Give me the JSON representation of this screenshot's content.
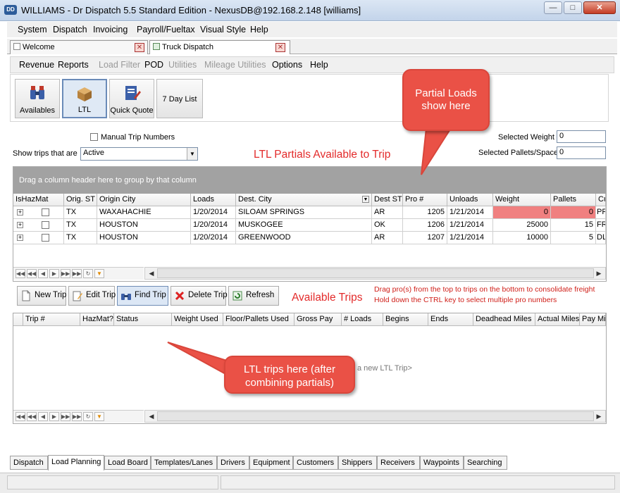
{
  "window": {
    "title": "WILLIAMS - Dr Dispatch 5.5 Standard Edition - NexusDB@192.168.2.148 [williams]"
  },
  "menu": [
    "System",
    "Dispatch",
    "Invoicing",
    "Payroll/Fueltax",
    "Visual Style",
    "Help"
  ],
  "doc_tabs": [
    "Welcome",
    "Truck Dispatch"
  ],
  "submenu": [
    {
      "label": "Revenue",
      "enabled": true
    },
    {
      "label": "Reports",
      "enabled": true
    },
    {
      "label": "Load Filter",
      "enabled": false
    },
    {
      "label": "POD",
      "enabled": true
    },
    {
      "label": "Utilities",
      "enabled": false
    },
    {
      "label": "Mileage Utilities",
      "enabled": false
    },
    {
      "label": "Options",
      "enabled": true
    },
    {
      "label": "Help",
      "enabled": true
    }
  ],
  "toolbar": {
    "availables": "Availables",
    "ltl": "LTL",
    "quick_quote": "Quick Quote",
    "seven_day": "7 Day List"
  },
  "options": {
    "manual_trip_numbers": "Manual Trip Numbers",
    "show_trips_label": "Show trips that are",
    "show_trips_value": "Active",
    "panel_title": "LTL Partials Available to Trip",
    "selected_weight_label": "Selected Weight",
    "selected_weight_value": "0",
    "selected_pallets_label": "Selected Pallets/Space",
    "selected_pallets_value": "0"
  },
  "partials_grid": {
    "group_hint": "Drag a column header here to group by that column",
    "columns": [
      "IsHazMat",
      "Orig. ST",
      "Origin City",
      "Loads",
      "Dest. City",
      "Dest ST",
      "Pro #",
      "Unloads",
      "Weight",
      "Pallets",
      "Cu"
    ],
    "rows": [
      {
        "orig_st": "TX",
        "origin_city": "WAXAHACHIE",
        "loads": "1/20/2014",
        "dest_city": "SILOAM SPRINGS",
        "dest_st": "AR",
        "pro": "1205",
        "unloads": "1/21/2014",
        "weight": "0",
        "pallets": "0",
        "cu": "PRA"
      },
      {
        "orig_st": "TX",
        "origin_city": "HOUSTON",
        "loads": "1/20/2014",
        "dest_city": "MUSKOGEE",
        "dest_st": "OK",
        "pro": "1206",
        "unloads": "1/21/2014",
        "weight": "25000",
        "pallets": "15",
        "cu": "FRE"
      },
      {
        "orig_st": "TX",
        "origin_city": "HOUSTON",
        "loads": "1/20/2014",
        "dest_city": "GREENWOOD",
        "dest_st": "AR",
        "pro": "1207",
        "unloads": "1/21/2014",
        "weight": "10000",
        "pallets": "5",
        "cu": "DLS"
      }
    ]
  },
  "actions": {
    "new_trip": "New Trip",
    "edit_trip": "Edit Trip",
    "find_trip": "Find Trip",
    "delete_trip": "Delete Trip",
    "refresh": "Refresh"
  },
  "available_trips_title": "Available Trips",
  "hint_line1": "Drag pro(s) from the top to trips on the bottom to consolidate freight",
  "hint_line2": "Hold down the CTRL key to select multiple pro numbers",
  "trips_grid": {
    "columns": [
      "Trip #",
      "HazMat?",
      "Status",
      "Weight Used",
      "Floor/Pallets Used",
      "Gross Pay",
      "# Loads",
      "Begins",
      "Ends",
      "Deadhead Miles",
      "Actual Miles",
      "Pay Miles"
    ],
    "empty_text": "a new LTL Trip>"
  },
  "callouts": {
    "partial_loads": "Partial Loads show here",
    "ltl_trips": "LTL trips here (after combining partials)"
  },
  "bottom_tabs": [
    "Dispatch",
    "Load Planning",
    "Load Board",
    "Templates/Lanes",
    "Drivers",
    "Equipment",
    "Customers",
    "Shippers",
    "Receivers",
    "Waypoints",
    "Searching"
  ],
  "colors": {
    "callout": "#ea5146",
    "highlight_cell": "#f08080",
    "red_text": "#e32b2b",
    "group_bar": "#a2a2a2"
  }
}
